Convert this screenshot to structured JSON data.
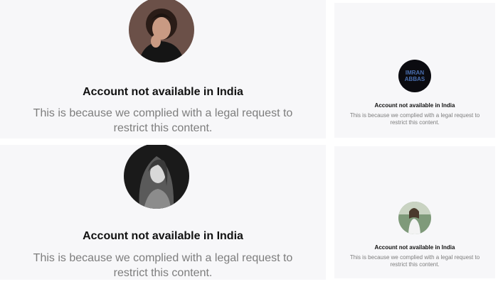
{
  "panels": [
    {
      "title": "Account not available in India",
      "message_line1": "This is because we complied with a legal request to",
      "message_line2": "restrict this content."
    },
    {
      "title": "Account not available in India",
      "message_line1": "This is because we complied with a legal request to",
      "message_line2": "restrict this content.",
      "avatar_text_line1": "IMRAN",
      "avatar_text_line2": "ABBAS"
    },
    {
      "title": "Account not available in India",
      "message_line1": "This is because we complied with a legal request to",
      "message_line2": "restrict this content."
    },
    {
      "title": "Account not available in India",
      "message_line1": "This is because we complied with a legal request to",
      "message_line2": "restrict this content."
    }
  ],
  "colors": {
    "panel_bg": "#f7f7f9",
    "title": "#111111",
    "message": "#7d7d7d"
  }
}
